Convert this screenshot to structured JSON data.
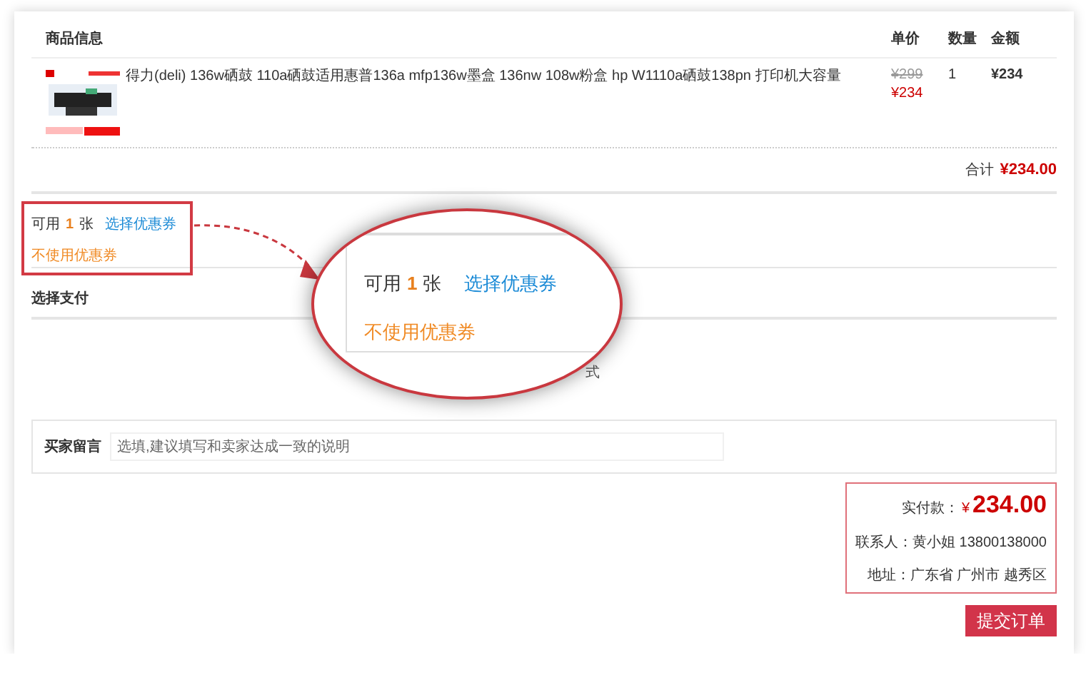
{
  "table": {
    "columns": [
      "商品信息",
      "单价",
      "数量",
      "金额"
    ],
    "rows": [
      {
        "title": "得力(deli) 136w硒鼓 110a硒鼓适用惠普136a mfp136w墨盒 136nw 108w粉盒 hp W1110a硒鼓138pn 打印机大容量",
        "original_price": "¥299",
        "price": "¥234",
        "quantity": "1",
        "amount": "¥234"
      }
    ]
  },
  "total": {
    "label": "合计",
    "value": "¥234.00"
  },
  "coupon": {
    "prefix": "可用",
    "count": "1",
    "unit": "张",
    "choose_link": "选择优惠券",
    "decline_link": "不使用优惠券"
  },
  "magnifier": {
    "prefix": "可用",
    "count": "1",
    "unit": "张",
    "choose_link": "选择优惠券",
    "decline_link": "不使用优惠券"
  },
  "payment": {
    "title": "选择支付",
    "partial_text": "式"
  },
  "message": {
    "label": "买家留言",
    "placeholder": "选填,建议填写和卖家达成一致的说明"
  },
  "summary": {
    "paid_label": "实付款：",
    "currency": "¥",
    "paid_amount": "234.00",
    "contact": "联系人：黄小姐 13800138000",
    "address": "地址：广东省 广州市 越秀区"
  },
  "submit_button": "提交订单"
}
